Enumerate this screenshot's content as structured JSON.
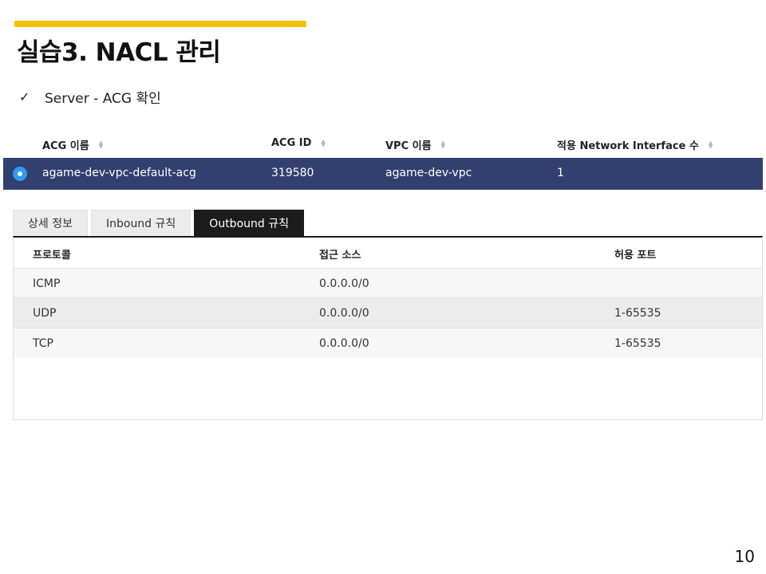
{
  "slide": {
    "title": "실습3. NACL 관리",
    "bullet": "Server - ACG 확인",
    "page_number": "10",
    "accent_color": "#f2c200"
  },
  "acg_table": {
    "headers": [
      "ACG 이름",
      "ACG ID",
      "VPC 이름",
      "적용 Network Interface 수"
    ],
    "row": {
      "selected": true,
      "name": "agame-dev-vpc-default-acg",
      "id": "319580",
      "vpc": "agame-dev-vpc",
      "ni_count": "1"
    },
    "row_color": "#324070"
  },
  "tabs": [
    {
      "label": "상세 정보",
      "active": false
    },
    {
      "label": "Inbound 규칙",
      "active": false
    },
    {
      "label": "Outbound 규칙",
      "active": true
    }
  ],
  "rules": {
    "headers": [
      "프로토콜",
      "접근 소스",
      "허용 포트"
    ],
    "rows": [
      {
        "protocol": "ICMP",
        "source": "0.0.0.0/0",
        "port": ""
      },
      {
        "protocol": "UDP",
        "source": "0.0.0.0/0",
        "port": "1-65535"
      },
      {
        "protocol": "TCP",
        "source": "0.0.0.0/0",
        "port": "1-65535"
      }
    ]
  }
}
